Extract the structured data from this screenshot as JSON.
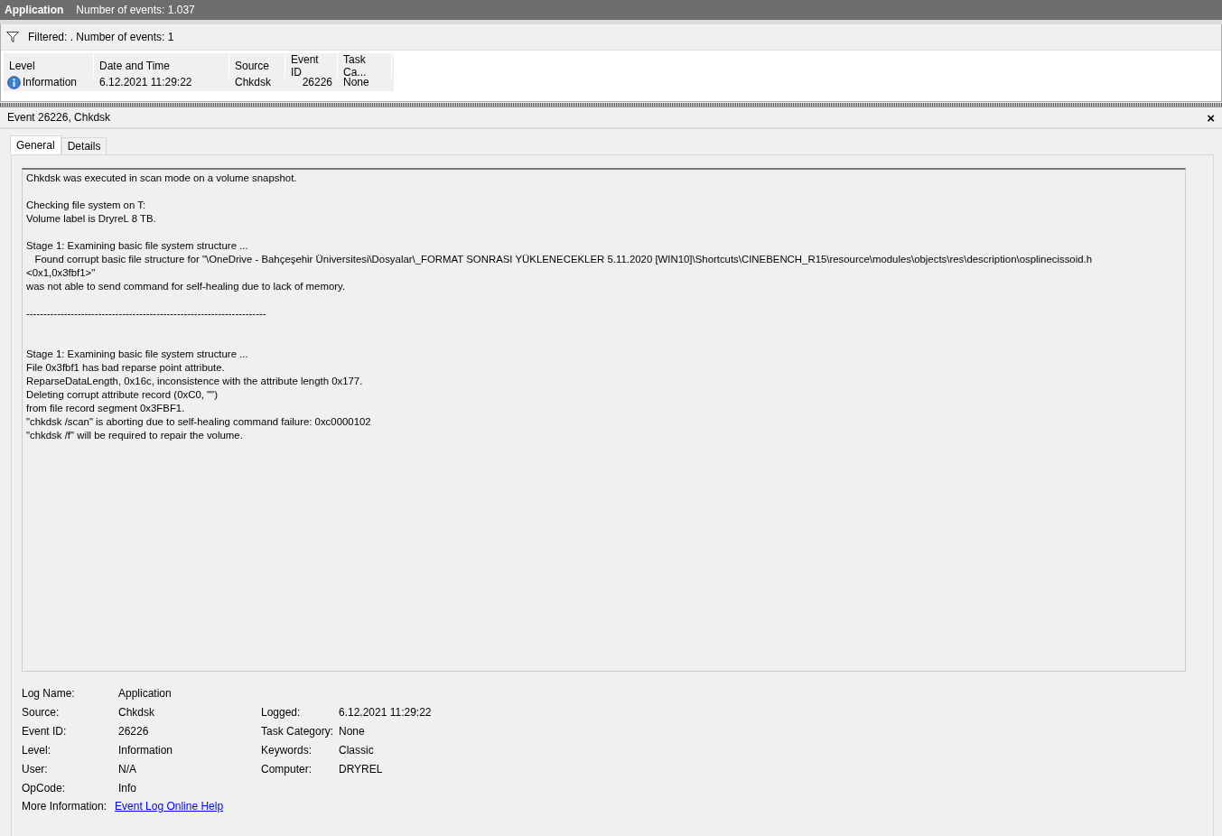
{
  "title_bar": {
    "log_name": "Application",
    "event_count": "Number of events: 1.037"
  },
  "filter_bar": {
    "text": "Filtered: . Number of events: 1"
  },
  "table": {
    "columns": [
      "Level",
      "Date and Time",
      "Source",
      "Event ID",
      "Task Ca..."
    ],
    "rows": [
      {
        "level": "Information",
        "date_time": "6.12.2021 11:29:22",
        "source": "Chkdsk",
        "event_id": "26226",
        "task_category": "None",
        "selected": true
      }
    ]
  },
  "detail": {
    "title": "Event 26226, Chkdsk",
    "close": "×",
    "tabs": [
      {
        "label": "General",
        "selected": true
      },
      {
        "label": "Details",
        "selected": false
      }
    ],
    "message": "Chkdsk was executed in scan mode on a volume snapshot.\n\nChecking file system on T:\nVolume label is DryreL 8 TB.\n\nStage 1: Examining basic file system structure ...\n   Found corrupt basic file structure for \"\\OneDrive - Bahçeşehir Üniversitesi\\Dosyalar\\_FORMAT SONRASI YÜKLENECEKLER 5.11.2020 [WIN10]\\Shortcuts\\CINEBENCH_R15\\resource\\modules\\objects\\res\\description\\osplinecissoid.h\n<0x1,0x3fbf1>\"\nwas not able to send command for self-healing due to lack of memory.\n\n----------------------------------------------------------------------\n\n\nStage 1: Examining basic file system structure ...\nFile 0x3fbf1 has bad reparse point attribute.\nReparseDataLength, 0x16c, inconsistence with the attribute length 0x177.\nDeleting corrupt attribute record (0xC0, \"\")\nfrom file record segment 0x3FBF1.\n\"chkdsk /scan\" is aborting due to self-healing command failure: 0xc0000102\n\"chkdsk /f\" will be required to repair the volume.",
    "fields_left": [
      {
        "label": "Log Name:",
        "value": "Application"
      },
      {
        "label": "Source:",
        "value": "Chkdsk"
      },
      {
        "label": "Event ID:",
        "value": "26226"
      },
      {
        "label": "Level:",
        "value": "Information"
      },
      {
        "label": "User:",
        "value": "N/A"
      },
      {
        "label": "OpCode:",
        "value": "Info"
      }
    ],
    "fields_right": [
      {
        "label": "Logged:",
        "value": "6.12.2021 11:29:22"
      },
      {
        "label": "Task Category:",
        "value": "None"
      },
      {
        "label": "Keywords:",
        "value": "Classic"
      },
      {
        "label": "Computer:",
        "value": "DRYREL"
      }
    ],
    "more_info": {
      "label": "More Information:",
      "link": "Event Log Online Help"
    }
  }
}
